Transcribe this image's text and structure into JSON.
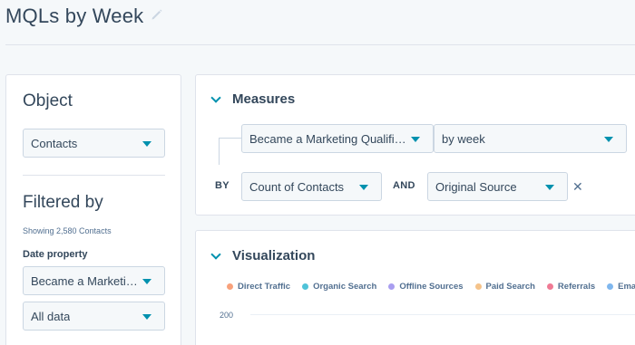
{
  "header": {
    "title": "MQLs by Week"
  },
  "left_panel": {
    "object_heading": "Object",
    "object_select": "Contacts",
    "filtered_heading": "Filtered by",
    "showing": "Showing 2,580 Contacts",
    "date_property_label": "Date property",
    "date_property_select": "Became a Marketi…",
    "range_select": "All data"
  },
  "measures": {
    "title": "Measures",
    "date_field": "Became a Marketing Qualifi…",
    "frequency": "by week",
    "by_label": "BY",
    "count_select": "Count of Contacts",
    "and_label": "AND",
    "breakdown_select": "Original Source",
    "remove_symbol": "✕"
  },
  "visualization": {
    "title": "Visualization",
    "legend": [
      {
        "label": "Direct Traffic",
        "color": "#f8a17b"
      },
      {
        "label": "Organic Search",
        "color": "#4fc3d8"
      },
      {
        "label": "Offline Sources",
        "color": "#a99ef0"
      },
      {
        "label": "Paid Search",
        "color": "#f5c38a"
      },
      {
        "label": "Referrals",
        "color": "#ef7a94"
      },
      {
        "label": "Email",
        "color": "#7fb7ee"
      }
    ],
    "y_tick": "200"
  },
  "colors": {
    "accent": "#0091ae",
    "text": "#33475b",
    "border": "#cbd6e2",
    "background": "#f5f8fa"
  }
}
